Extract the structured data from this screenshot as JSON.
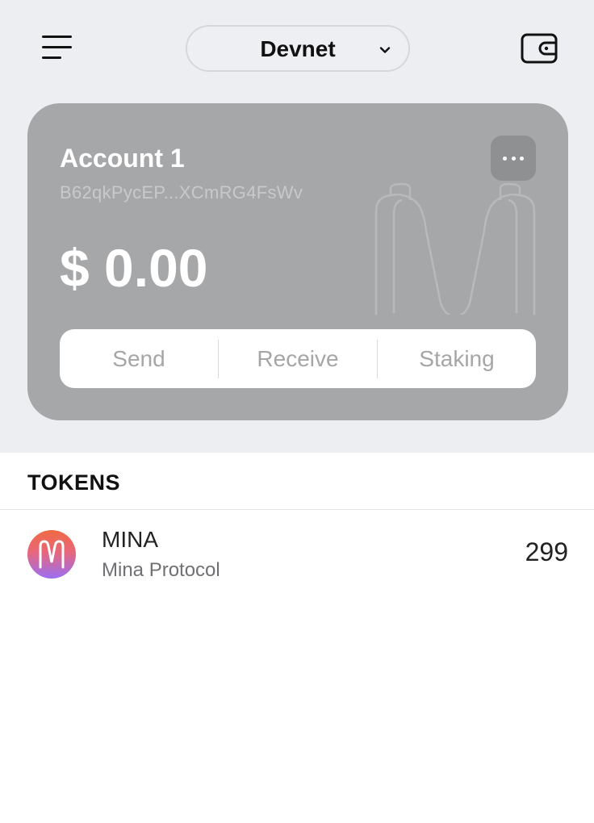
{
  "header": {
    "network": "Devnet",
    "icons": {
      "menu": "hamburger-menu-icon",
      "network_dropdown": "chevron-down-icon",
      "wallet": "wallet-icon"
    }
  },
  "account_card": {
    "name": "Account 1",
    "address": "B62qkPycEP...XCmRG4FsWv",
    "balance": "$ 0.00",
    "more_icon": "ellipsis-icon",
    "actions": {
      "send": "Send",
      "receive": "Receive",
      "staking": "Staking"
    }
  },
  "tokens": {
    "title": "TOKENS",
    "items": [
      {
        "symbol": "MINA",
        "name": "Mina Protocol",
        "amount": "299",
        "icon": "mina-logo"
      }
    ]
  },
  "colors": {
    "page_background": "#edeef2",
    "card_background": "#a6a7a9",
    "action_text": "#a5a6a8",
    "mina_gradient_top": "#f06a42",
    "mina_gradient_bottom": "#9b6ef5"
  }
}
